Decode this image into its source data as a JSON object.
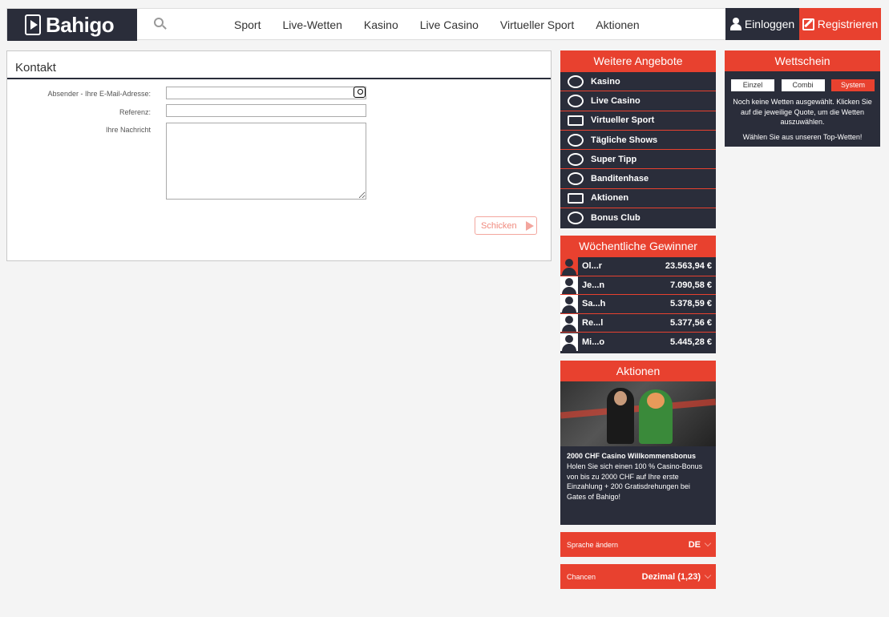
{
  "header": {
    "logo_text": "Bahigo",
    "nav": [
      "Sport",
      "Live-Wetten",
      "Kasino",
      "Live Casino",
      "Virtueller Sport",
      "Aktionen"
    ],
    "login_label": "Einloggen",
    "register_label": "Registrieren"
  },
  "contact": {
    "title": "Kontakt",
    "email_label": "Absender - Ihre E-Mail-Adresse:",
    "email_value": "",
    "ref_label": "Referenz:",
    "ref_value": "",
    "message_label": "Ihre Nachricht",
    "message_value": "",
    "send_label": "Schicken"
  },
  "offers": {
    "title": "Weitere Angebote",
    "items": [
      "Kasino",
      "Live Casino",
      "Virtueller Sport",
      "Tägliche Shows",
      "Super Tipp",
      "Banditenhase",
      "Aktionen",
      "Bonus Club"
    ]
  },
  "winners": {
    "title": "Wöchentliche Gewinner",
    "rows": [
      {
        "name": "Ol...r",
        "amount": "23.563,94 €"
      },
      {
        "name": "Je...n",
        "amount": "7.090,58 €"
      },
      {
        "name": "Sa...h",
        "amount": "5.378,59 €"
      },
      {
        "name": "Re...l",
        "amount": "5.377,56 €"
      },
      {
        "name": "Mi...o",
        "amount": "5.445,28 €"
      }
    ]
  },
  "promos": {
    "title": "Aktionen",
    "headline": "2000 CHF Casino Willkommensbonus",
    "body": "Holen Sie sich einen 100 % Casino-Bonus von bis zu 2000 CHF auf Ihre erste Einzahlung + 200 Gratisdrehungen bei Gates of Bahigo!"
  },
  "language": {
    "label": "Sprache ändern",
    "value": "DE"
  },
  "odds": {
    "label": "Chancen",
    "value": "Dezimal (1,23)"
  },
  "betslip": {
    "title": "Wettschein",
    "tabs": [
      "Einzel",
      "Combi",
      "System"
    ],
    "active_tab": "System",
    "message": "Noch keine Wetten ausgewählt. Klicken Sie auf die jeweilige Quote, um die Wetten auszuwählen.",
    "top_bets": "Wählen Sie aus unseren Top-Wetten!"
  },
  "colors": {
    "accent": "#e8412f",
    "dark": "#2a2d3a"
  }
}
